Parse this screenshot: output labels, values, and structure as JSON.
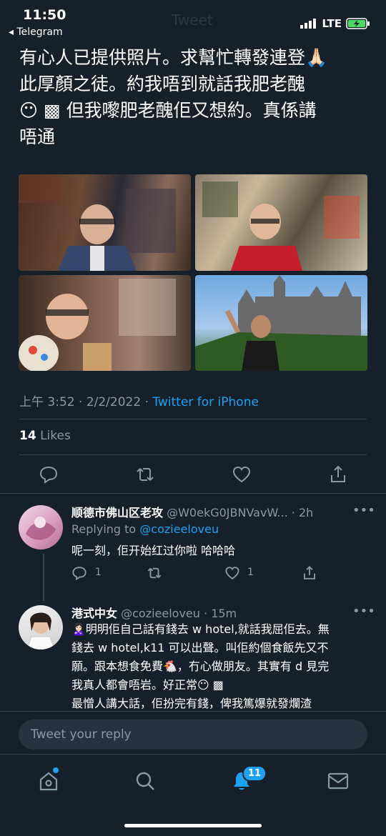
{
  "status": {
    "time": "11:50",
    "back_app": "Telegram",
    "network": "LTE"
  },
  "header": {
    "faded_title": "Tweet"
  },
  "tweet": {
    "line1": "有心人已提供照片。求幫忙轉發連登🙏🏻",
    "line2": "此厚顏之徒。約我唔到就話我肥老醜",
    "line3": "😶 ▩ 但我嚟肥老醜佢又想約。真係講",
    "line4": "唔通",
    "time": "上午 3:52",
    "date": "2/2/2022",
    "source": "Twitter for iPhone",
    "likes_count": "14",
    "likes_label": "Likes"
  },
  "replies": [
    {
      "name": "顺德市佛山区老攻",
      "handle": "@W0ekG0JBNVavW...",
      "time": "· 2h",
      "replying_label": "Replying to ",
      "replying_to": "@cozieeloveu",
      "text": "呢一刻，佢开始红过你啦 哈哈哈",
      "reply_count": "1",
      "like_count": "1"
    },
    {
      "name": "港式中女",
      "handle": "@cozieeloveu",
      "time": "· 15m",
      "l1": "🙎🏻‍♀️明明佢自己話有錢去 w hotel,就話我屈佢去。無",
      "l2": "錢去 w hotel,k11 可以出聲。叫佢約個食飯先又不",
      "l3": "願。跟本想食免費🐔，冇心做朋友。其實有 d 見完",
      "l4": "我真人都會唔岩。好正常😶 ▩",
      "l5": "最憎人講大話，佢扮完有錢，俾我篤爆就發爛渣"
    }
  ],
  "composer": {
    "placeholder": "Tweet your reply"
  },
  "tabbar": {
    "notifications_badge": "11"
  },
  "colors": {
    "background": "#15202b",
    "accent": "#1da1f2",
    "muted": "#8899a6"
  }
}
